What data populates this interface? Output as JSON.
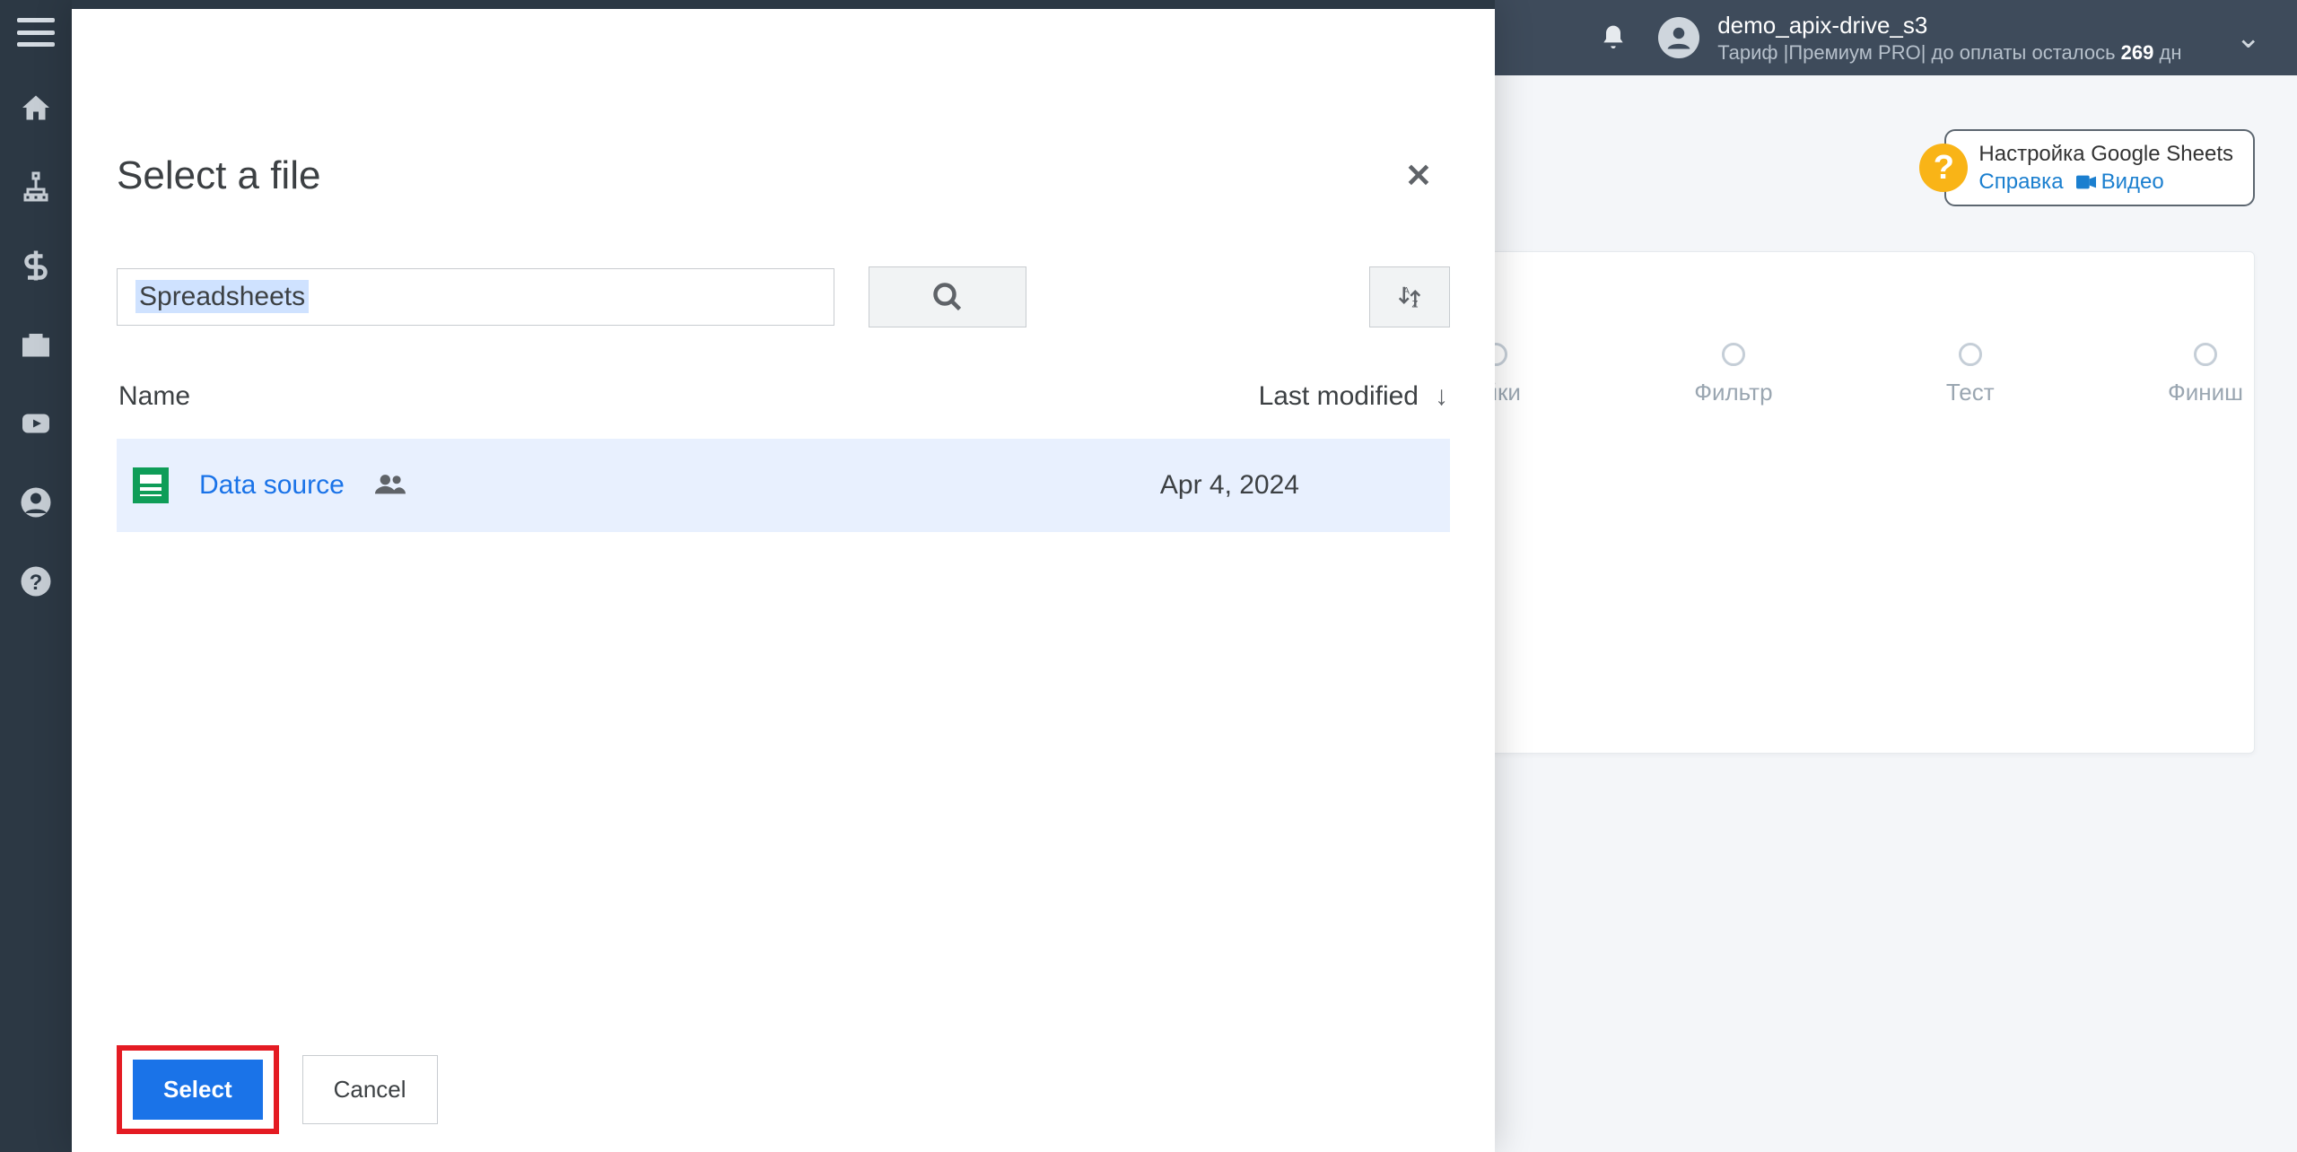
{
  "header": {
    "username": "demo_apix-drive_s3",
    "tariff_prefix": "Тариф |Премиум PRO| до оплаты осталось ",
    "tariff_days": "269",
    "tariff_suffix": " дн"
  },
  "help": {
    "title": "Настройка Google Sheets",
    "link_help": "Справка",
    "link_video": "Видео"
  },
  "steps": {
    "s1": "ойки",
    "s2": "Фильтр",
    "s3": "Тест",
    "s4": "Финиш"
  },
  "picker": {
    "title": "Select a file",
    "chip": "Spreadsheets",
    "col_name": "Name",
    "col_modified": "Last modified",
    "file_name": "Data source",
    "file_date": "Apr 4, 2024",
    "select": "Select",
    "cancel": "Cancel"
  }
}
